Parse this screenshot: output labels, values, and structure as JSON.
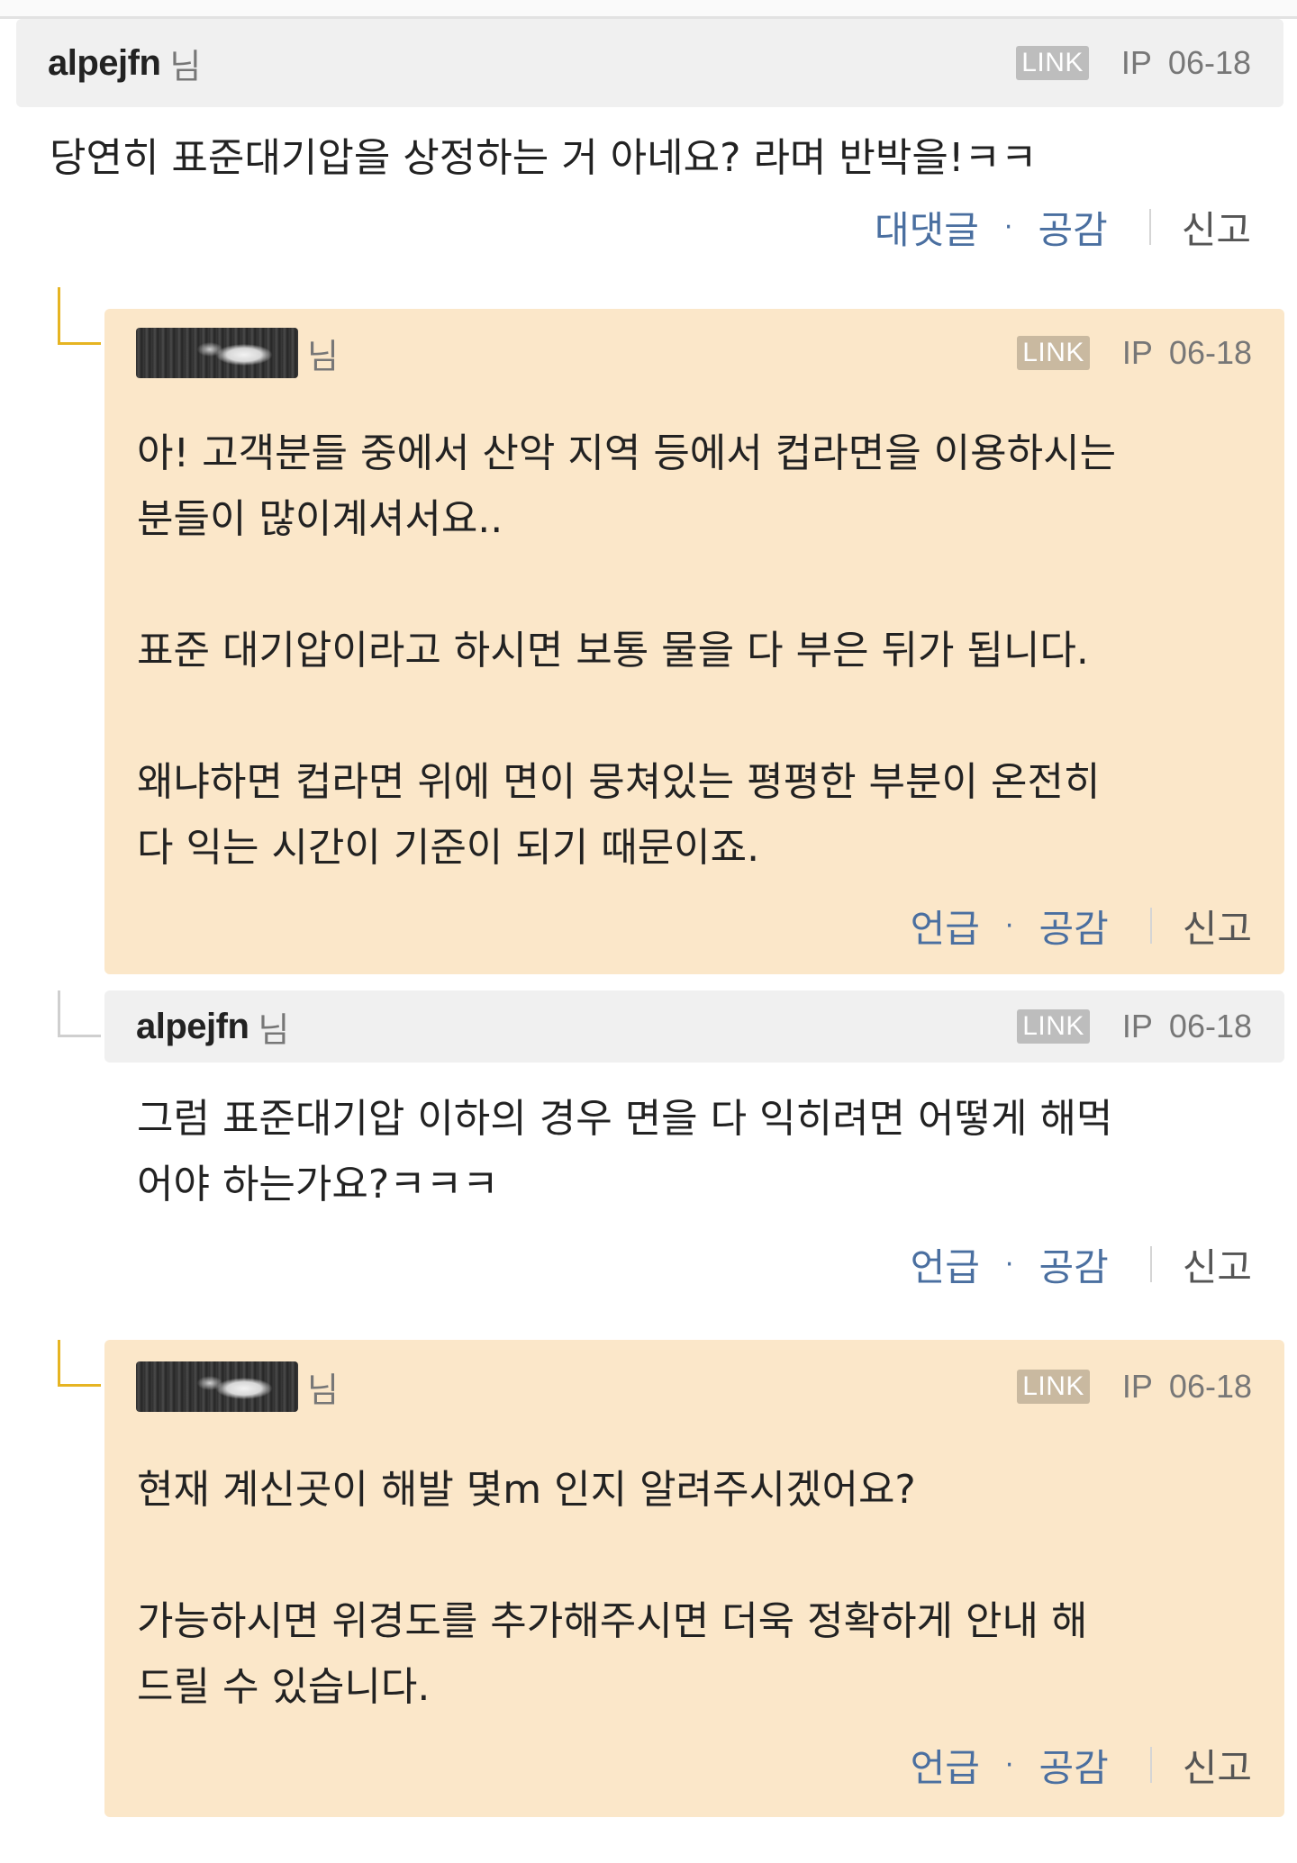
{
  "comments": [
    {
      "author": "alpejfn",
      "suffix": "님",
      "link": "LINK",
      "ip": "IP",
      "date": "06-18",
      "text": "당연히 표준대기압을 상정하는 거 아네요? 라며 반박을!ㅋㅋ",
      "actions": {
        "reply": "대댓글",
        "like": "공감",
        "report": "신고"
      }
    },
    {
      "author_avatar": "blurred-username-image",
      "suffix": "님",
      "link": "LINK",
      "ip": "IP",
      "date": "06-18",
      "text": "아! 고객분들 중에서 산악 지역 등에서 컵라면을 이용하시는\n분들이 많이계셔서요..\n\n표준 대기압이라고 하시면 보통 물을 다 부은 뒤가 됩니다.\n\n왜냐하면 컵라면 위에 면이 뭉쳐있는 평평한 부분이 온전히\n다 익는 시간이 기준이 되기 때문이죠.",
      "actions": {
        "reply": "언급",
        "like": "공감",
        "report": "신고"
      }
    },
    {
      "author": "alpejfn",
      "suffix": "님",
      "link": "LINK",
      "ip": "IP",
      "date": "06-18",
      "text": "그럼 표준대기압 이하의 경우 면을 다 익히려면 어떻게 해먹\n어야 하는가요?ㅋㅋㅋ",
      "actions": {
        "reply": "언급",
        "like": "공감",
        "report": "신고"
      }
    },
    {
      "author_avatar": "blurred-username-image",
      "suffix": "님",
      "link": "LINK",
      "ip": "IP",
      "date": "06-18",
      "text": "현재 계신곳이 해발 몇m 인지 알려주시겠어요?\n\n가능하시면 위경도를 추가해주시면 더욱 정확하게 안내 해\n드릴 수 있습니다.",
      "actions": {
        "reply": "언급",
        "like": "공감",
        "report": "신고"
      }
    }
  ]
}
